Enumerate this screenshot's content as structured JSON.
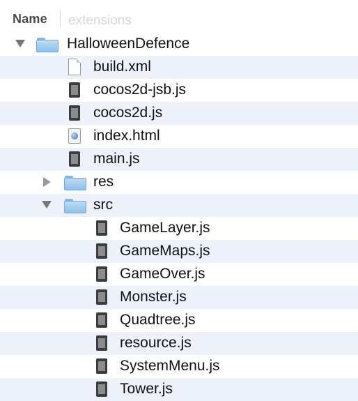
{
  "header": {
    "column_name": "Name",
    "next_column": "extensions"
  },
  "tree": {
    "root": "HalloweenDefence",
    "files": {
      "build_xml": "build.xml",
      "cocos2d_jsb": "cocos2d-jsb.js",
      "cocos2d": "cocos2d.js",
      "index_html": "index.html",
      "main_js": "main.js"
    },
    "res_folder": "res",
    "src_folder": "src",
    "src_files": {
      "gamelayer": "GameLayer.js",
      "gamemaps": "GameMaps.js",
      "gameover": "GameOver.js",
      "monster": "Monster.js",
      "quadtree": "Quadtree.js",
      "resource": "resource.js",
      "systemmenu": "SystemMenu.js",
      "tower": "Tower.js"
    }
  },
  "icons": {
    "folder": "folder-icon",
    "generic_file": "document-icon",
    "script_file": "javascript-file-icon",
    "html_file": "html-file-icon",
    "disclosure_open": "disclosure-open-icon",
    "disclosure_closed": "disclosure-closed-icon"
  },
  "colors": {
    "stripe": "#edf2fa",
    "folder": "#8ec0ea"
  }
}
